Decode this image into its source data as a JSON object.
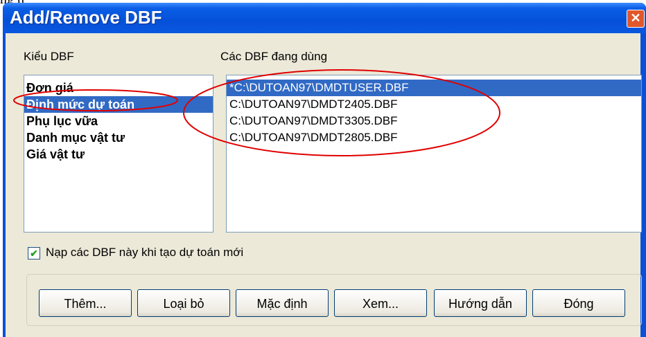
{
  "window": {
    "title": "Add/Remove DBF"
  },
  "labels": {
    "types": "Kiểu DBF",
    "used": "Các DBF đang dùng",
    "load_option": "Nạp các DBF này khi tạo dự toán mới"
  },
  "dbf_types": [
    {
      "label": "Đơn giá",
      "selected": false
    },
    {
      "label": "Định mức dự toán",
      "selected": true
    },
    {
      "label": "Phụ lục vữa",
      "selected": false
    },
    {
      "label": "Danh mục vật tư",
      "selected": false
    },
    {
      "label": "Giá vật tư",
      "selected": false
    }
  ],
  "dbf_files": [
    {
      "path": "*C:\\DUTOAN97\\DMDTUSER.DBF",
      "selected": true
    },
    {
      "path": "C:\\DUTOAN97\\DMDT2405.DBF",
      "selected": false
    },
    {
      "path": "C:\\DUTOAN97\\DMDT3305.DBF",
      "selected": false
    },
    {
      "path": "C:\\DUTOAN97\\DMDT2805.DBF",
      "selected": false
    }
  ],
  "load_checked": true,
  "buttons": {
    "add": "Thêm...",
    "remove": "Loại bỏ",
    "default": "Mặc định",
    "view": "Xem...",
    "guide": "Hướng dẫn",
    "close": "Đóng"
  },
  "colors": {
    "titlebar": "#0550d8",
    "selection": "#316ac5",
    "annotation": "#e00000"
  },
  "icons": {
    "close": "close-icon",
    "check": "check-icon"
  }
}
